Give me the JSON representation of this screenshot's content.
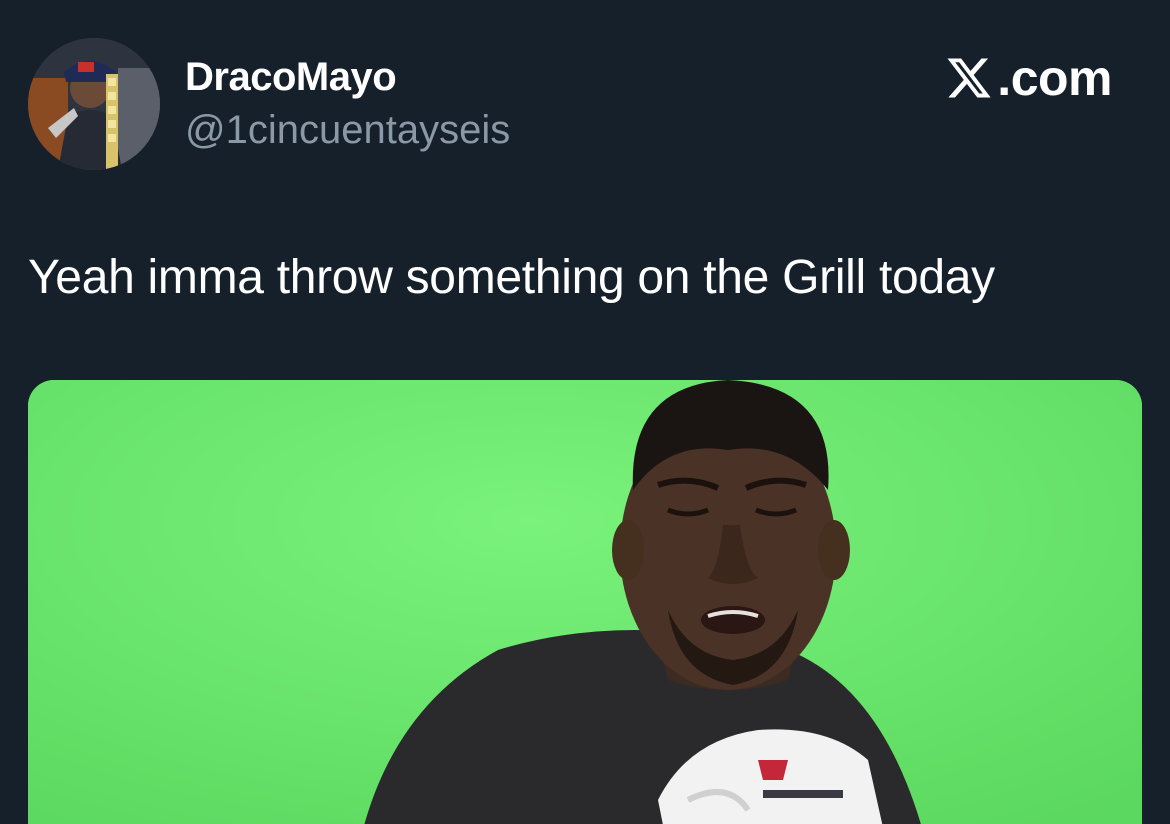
{
  "user": {
    "display_name": "DracoMayo",
    "handle": "@1cincuentayseis"
  },
  "brand": {
    "icon": "x-logo-icon",
    "text": ".com"
  },
  "tweet": {
    "text": "Yeah imma throw something on the Grill today"
  },
  "colors": {
    "background": "#15202b",
    "handle": "#8b98a5",
    "green_screen": "#64e268"
  }
}
